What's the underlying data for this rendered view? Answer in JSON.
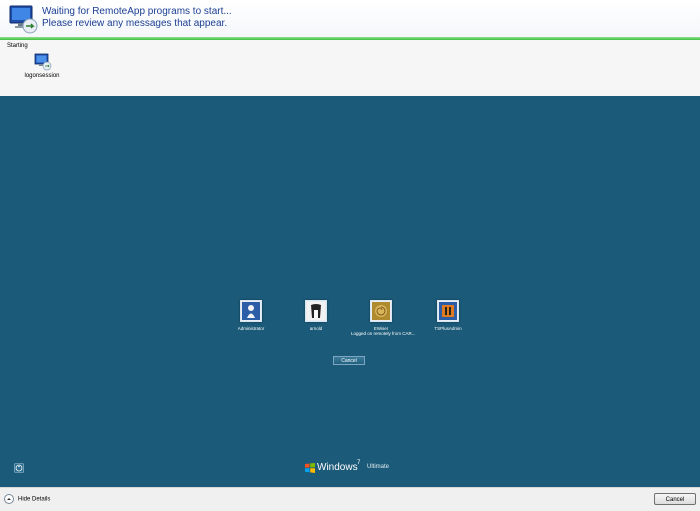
{
  "header": {
    "line1": "Waiting for RemoteApp programs to start...",
    "line2": "Please review any messages that appear."
  },
  "details": {
    "status": "Starting",
    "session_label": "logonsession"
  },
  "remote": {
    "users": [
      {
        "name": "Administrator",
        "sub": ""
      },
      {
        "name": "arnold",
        "sub": ""
      },
      {
        "name": "EWiser",
        "sub": "Logged on remotely from CAR..."
      },
      {
        "name": "TSPlusAdmin",
        "sub": ""
      }
    ],
    "cancel_label": "Cancel",
    "brand_word": "Windows",
    "brand_seven": "7",
    "brand_edition": "Ultimate"
  },
  "footer": {
    "hide_details_label": "Hide Details",
    "cancel_label": "Cancel"
  }
}
